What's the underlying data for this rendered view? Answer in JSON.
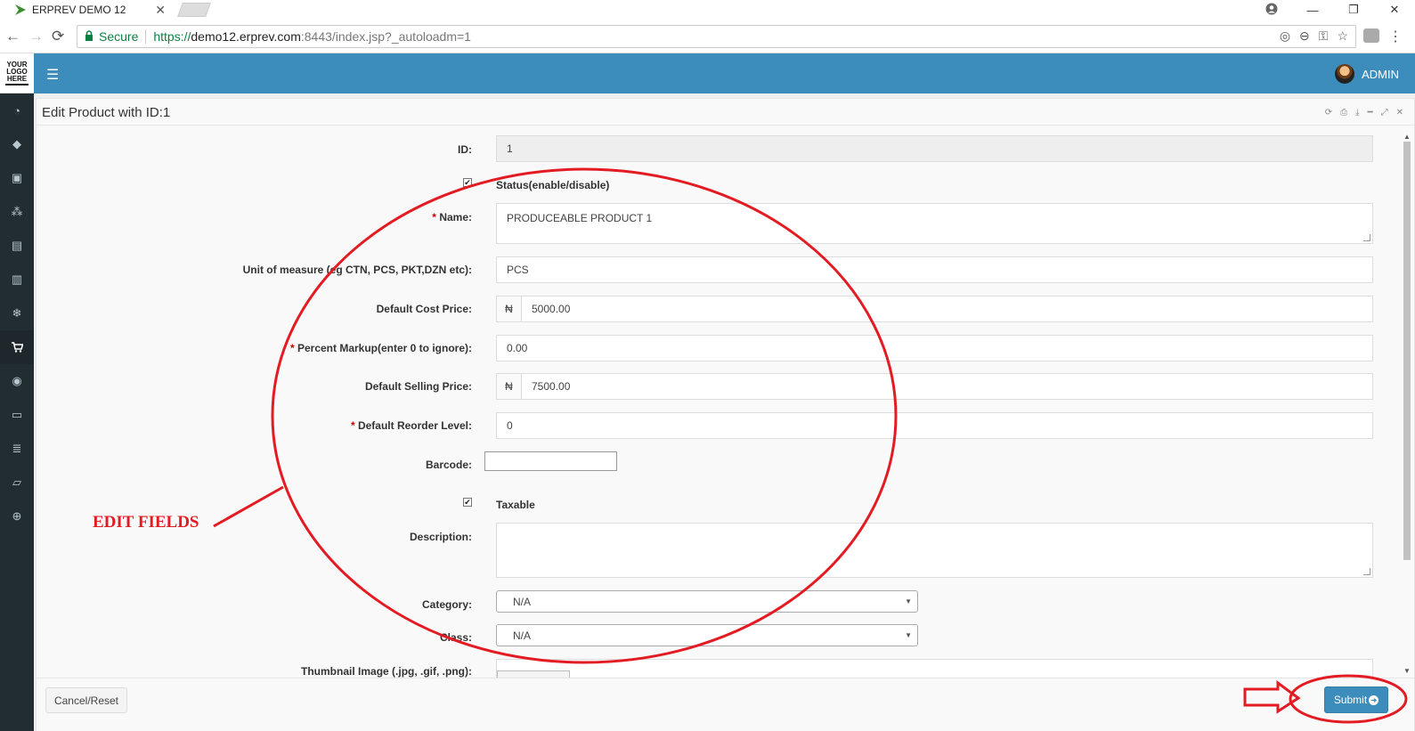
{
  "browser": {
    "tab_title": "ERPREV DEMO 12",
    "tab_close": "✕",
    "secure_label": "Secure",
    "url_scheme": "https://",
    "url_host": "demo12.erprev.com",
    "url_rest": ":8443/index.jsp?_autoloadm=1",
    "window_minimize": "—",
    "window_restore": "❐",
    "window_close": "✕"
  },
  "app": {
    "logo_lines": [
      "YOUR",
      "LOGO",
      "HERE"
    ],
    "user_name": "ADMIN",
    "brand_color": "#3c8dbc",
    "sidebar_color": "#222d32"
  },
  "panel": {
    "title": "Edit Product with ID:1"
  },
  "form": {
    "id_label": "ID:",
    "id_value": "1",
    "status_label": "Status(enable/disable)",
    "status_checked": "✔",
    "name_req": "*",
    "name_label": "Name:",
    "name_value": "PRODUCEABLE PRODUCT 1",
    "uom_label": "Unit of measure (eg CTN, PCS, PKT,DZN etc):",
    "uom_value": "PCS",
    "cost_label": "Default Cost Price:",
    "currency_symbol": "₦",
    "cost_value": "5000.00",
    "markup_req": "*",
    "markup_label": "Percent Markup(enter 0 to ignore):",
    "markup_value": "0.00",
    "selling_label": "Default Selling Price:",
    "selling_value": "7500.00",
    "reorder_req": "*",
    "reorder_label": "Default Reorder Level:",
    "reorder_value": "0",
    "barcode_label": "Barcode:",
    "taxable_label": "Taxable",
    "taxable_checked": "✔",
    "description_label": "Description:",
    "category_label": "Category:",
    "category_value": "N/A",
    "class_label": "Class:",
    "class_value": "N/A",
    "thumbnail_label": "Thumbnail Image (.jpg, .gif, .png):"
  },
  "footer": {
    "cancel_label": "Cancel/Reset",
    "submit_label": "Submit"
  },
  "annotations": {
    "edit_fields_label": "EDIT FIELDS",
    "color": "#e31b23"
  }
}
